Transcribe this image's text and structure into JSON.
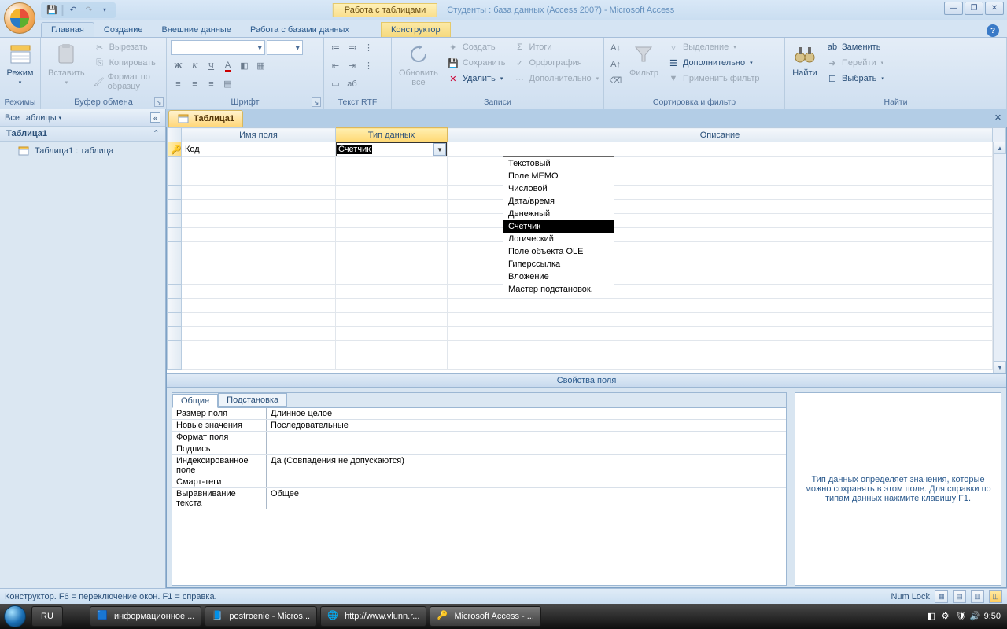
{
  "title": {
    "context_tab": "Работа с таблицами",
    "window_title": "Студенты : база данных (Access 2007) - Microsoft Access"
  },
  "tabs": {
    "t1": "Главная",
    "t2": "Создание",
    "t3": "Внешние данные",
    "t4": "Работа с базами данных",
    "t5": "Конструктор"
  },
  "ribbon": {
    "views": {
      "label": "Режимы",
      "btn": "Режим"
    },
    "clipboard": {
      "label": "Буфер обмена",
      "paste": "Вставить",
      "cut": "Вырезать",
      "copy": "Копировать",
      "fmt": "Формат по образцу"
    },
    "font": {
      "label": "Шрифт"
    },
    "richtext": {
      "label": "Текст RTF"
    },
    "records": {
      "label": "Записи",
      "refresh": "Обновить\nвсе",
      "new": "Создать",
      "save": "Сохранить",
      "delete": "Удалить",
      "totals": "Итоги",
      "spell": "Орфография",
      "more": "Дополнительно"
    },
    "sort": {
      "label": "Сортировка и фильтр",
      "filter": "Фильтр",
      "sel": "Выделение",
      "adv": "Дополнительно",
      "toggle": "Применить фильтр"
    },
    "find": {
      "label": "Найти",
      "find": "Найти",
      "replace": "Заменить",
      "goto": "Перейти",
      "select": "Выбрать"
    }
  },
  "nav": {
    "header": "Все таблицы",
    "group": "Таблица1",
    "item": "Таблица1 : таблица"
  },
  "doc": {
    "tab": "Таблица1"
  },
  "grid": {
    "h_name": "Имя поля",
    "h_type": "Тип данных",
    "h_desc": "Описание",
    "r1_name": "Код",
    "r1_type": "Счетчик"
  },
  "datatypes": [
    "Текстовый",
    "Поле МЕМО",
    "Числовой",
    "Дата/время",
    "Денежный",
    "Счетчик",
    "Логический",
    "Поле объекта OLE",
    "Гиперссылка",
    "Вложение",
    "Мастер подстановок."
  ],
  "split_label": "Свойства поля",
  "prop_tabs": {
    "general": "Общие",
    "lookup": "Подстановка"
  },
  "props": {
    "p1l": "Размер поля",
    "p1v": "Длинное целое",
    "p2l": "Новые значения",
    "p2v": "Последовательные",
    "p3l": "Формат поля",
    "p3v": "",
    "p4l": "Подпись",
    "p4v": "",
    "p5l": "Индексированное поле",
    "p5v": "Да (Совпадения не допускаются)",
    "p6l": "Смарт-теги",
    "p6v": "",
    "p7l": "Выравнивание текста",
    "p7v": "Общее"
  },
  "help_text": "Тип данных определяет значения, которые можно сохранять в этом поле.  Для справки по типам данных нажмите клавишу F1.",
  "status": {
    "left": "Конструктор.  F6 = переключение окон.  F1 = справка.",
    "numlock": "Num Lock"
  },
  "taskbar": {
    "lang": "RU",
    "t1": "информационное ...",
    "t2": "postroenie - Micros...",
    "t3": "http://www.vlunn.r...",
    "t4": "Microsoft Access - ...",
    "time": "9:50"
  }
}
